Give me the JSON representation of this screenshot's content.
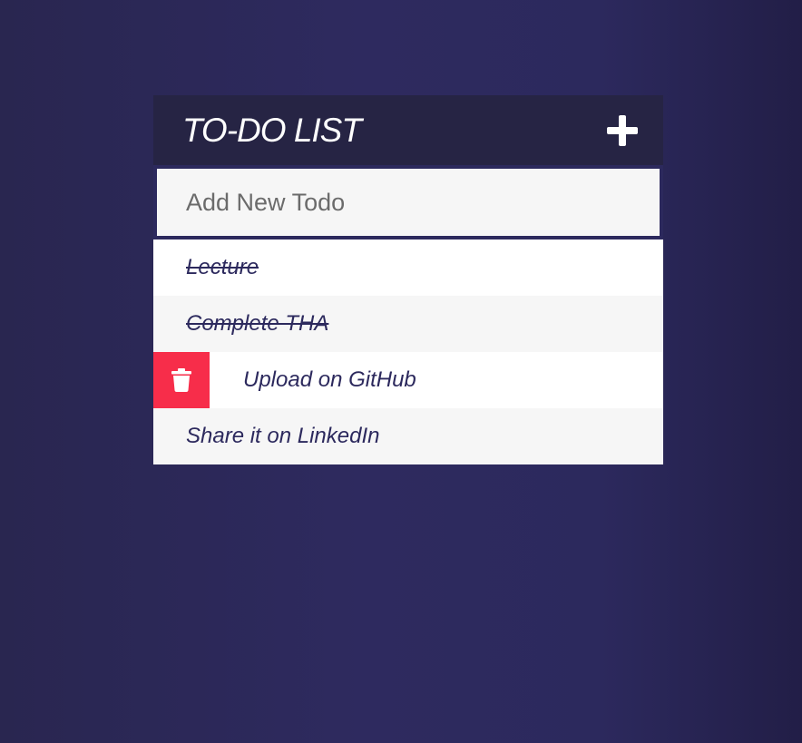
{
  "header": {
    "title": "TO-DO LIST"
  },
  "new_todo": {
    "placeholder": "Add New Todo",
    "value": ""
  },
  "todos": [
    {
      "text": "Lecture",
      "completed": true
    },
    {
      "text": "Complete THA",
      "completed": true
    },
    {
      "text": "Upload on GitHub",
      "completed": false,
      "delete_visible": true
    },
    {
      "text": "Share it on LinkedIn",
      "completed": false
    }
  ],
  "icons": {
    "add": "plus-icon",
    "delete": "trash-icon"
  },
  "colors": {
    "header_bg": "#262444",
    "delete_bg": "#f72d4a",
    "text": "#2c295d"
  }
}
